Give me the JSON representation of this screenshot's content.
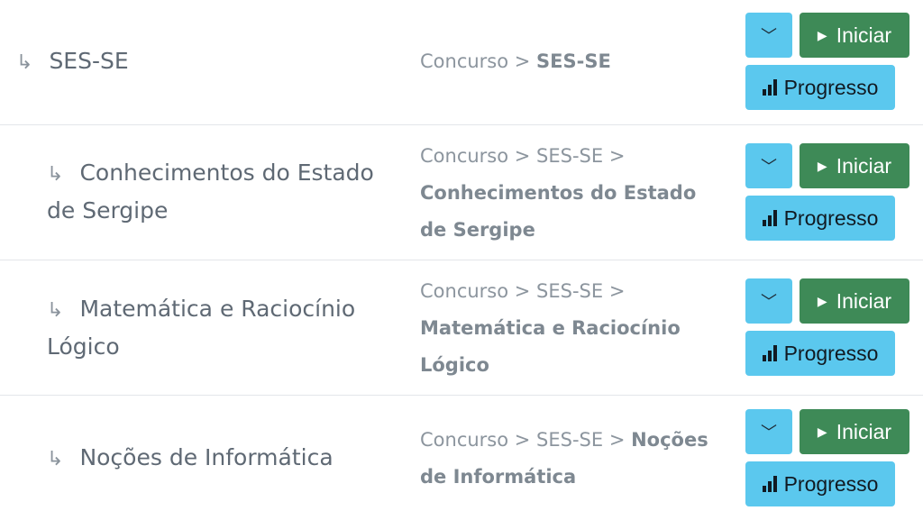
{
  "rows": [
    {
      "name": "SES-SE",
      "crumb_prefix": "Concurso > ",
      "crumb_bold": "SES-SE",
      "toggle_icon": "﹀",
      "start_label": "Iniciar",
      "progress_label": "Progresso"
    },
    {
      "name": "Conhecimentos do Estado de Sergipe",
      "crumb_prefix": "Concurso > SES-SE > ",
      "crumb_bold": "Conhecimentos do Estado de Sergipe",
      "toggle_icon": "﹀",
      "start_label": "Iniciar",
      "progress_label": "Progresso"
    },
    {
      "name": "Matemática e Raciocínio Lógico",
      "crumb_prefix": "Concurso > SES-SE > ",
      "crumb_bold": "Matemática e Raciocínio Lógico",
      "toggle_icon": "﹀",
      "start_label": "Iniciar",
      "progress_label": "Progresso"
    },
    {
      "name": "Noções de Informática",
      "crumb_prefix": "Concurso > SES-SE > ",
      "crumb_bold": "Noções de Informática",
      "toggle_icon": "﹀",
      "start_label": "Iniciar",
      "progress_label": "Progresso"
    }
  ],
  "icons": {
    "arrow": "↳",
    "play": "▶",
    "progress": "signal-bars-icon"
  },
  "colors": {
    "start": "#3e8a57",
    "info": "#5bc8ee"
  }
}
